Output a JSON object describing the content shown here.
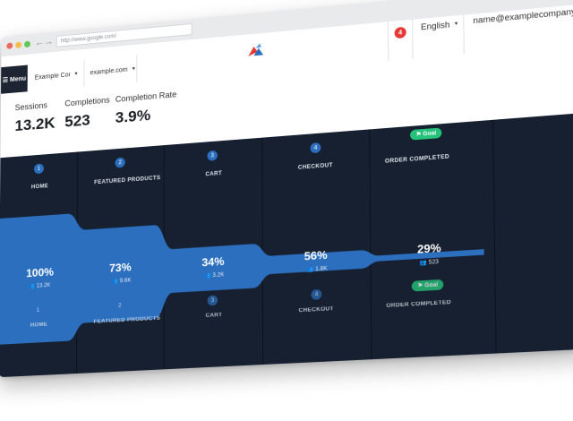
{
  "browser": {
    "url": "http://www.google.com/",
    "nav_back_icon": "arrow-left-icon",
    "nav_forward_icon": "arrow-right-icon",
    "resize_icon": "expand-icon",
    "traffic_lights": [
      "#ed6a5e",
      "#f5be4f",
      "#62c554"
    ]
  },
  "topbar": {
    "menu_label": "Menu",
    "company": "Example Company",
    "domain": "example.com",
    "notifications": "4",
    "language": "English",
    "account": "name@examplecompany.com"
  },
  "stats": [
    {
      "label": "Sessions",
      "value": "13.2K"
    },
    {
      "label": "Completions",
      "value": "523"
    },
    {
      "label": "Completion Rate",
      "value": "3.9%"
    }
  ],
  "funnel": {
    "goal_label": "Goal",
    "steps": [
      {
        "num": "1",
        "name": "HOME",
        "pct": "100%",
        "count": "13.2K",
        "fraction": 1.0
      },
      {
        "num": "2",
        "name": "FEATURED PRODUCTS",
        "pct": "73%",
        "count": "9.6K",
        "fraction": 0.73
      },
      {
        "num": "3",
        "name": "CART",
        "pct": "34%",
        "count": "3.2K",
        "fraction": 0.34
      },
      {
        "num": "4",
        "name": "CHECKOUT",
        "pct": "56%",
        "count": "1.8K",
        "fraction": 0.14
      },
      {
        "num": "5",
        "name": "ORDER COMPLETED",
        "pct": "29%",
        "count": "523",
        "fraction": 0.04
      }
    ]
  },
  "colors": {
    "funnel_bg": "#162030",
    "flow": "#2c6fbf",
    "goal": "#25c27a",
    "badge": "#e53935",
    "menu_bg": "#1d2532"
  }
}
